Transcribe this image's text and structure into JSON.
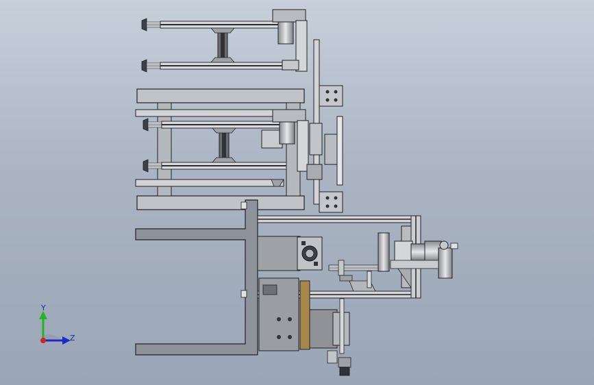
{
  "viewport": {
    "background_top": "#c7d0db",
    "background_bottom": "#9aa6b6"
  },
  "triad": {
    "y_label": "Y",
    "z_label": "Z",
    "x_axis_color": "#d61f1f",
    "y_axis_color": "#22b422",
    "z_axis_color": "#1b2acb"
  },
  "model": {
    "metal_color": "#bfc3c7",
    "dark_metal_color": "#4a4d52",
    "bronze_color": "#a6894a",
    "base_plate_color": "#8e929a"
  }
}
